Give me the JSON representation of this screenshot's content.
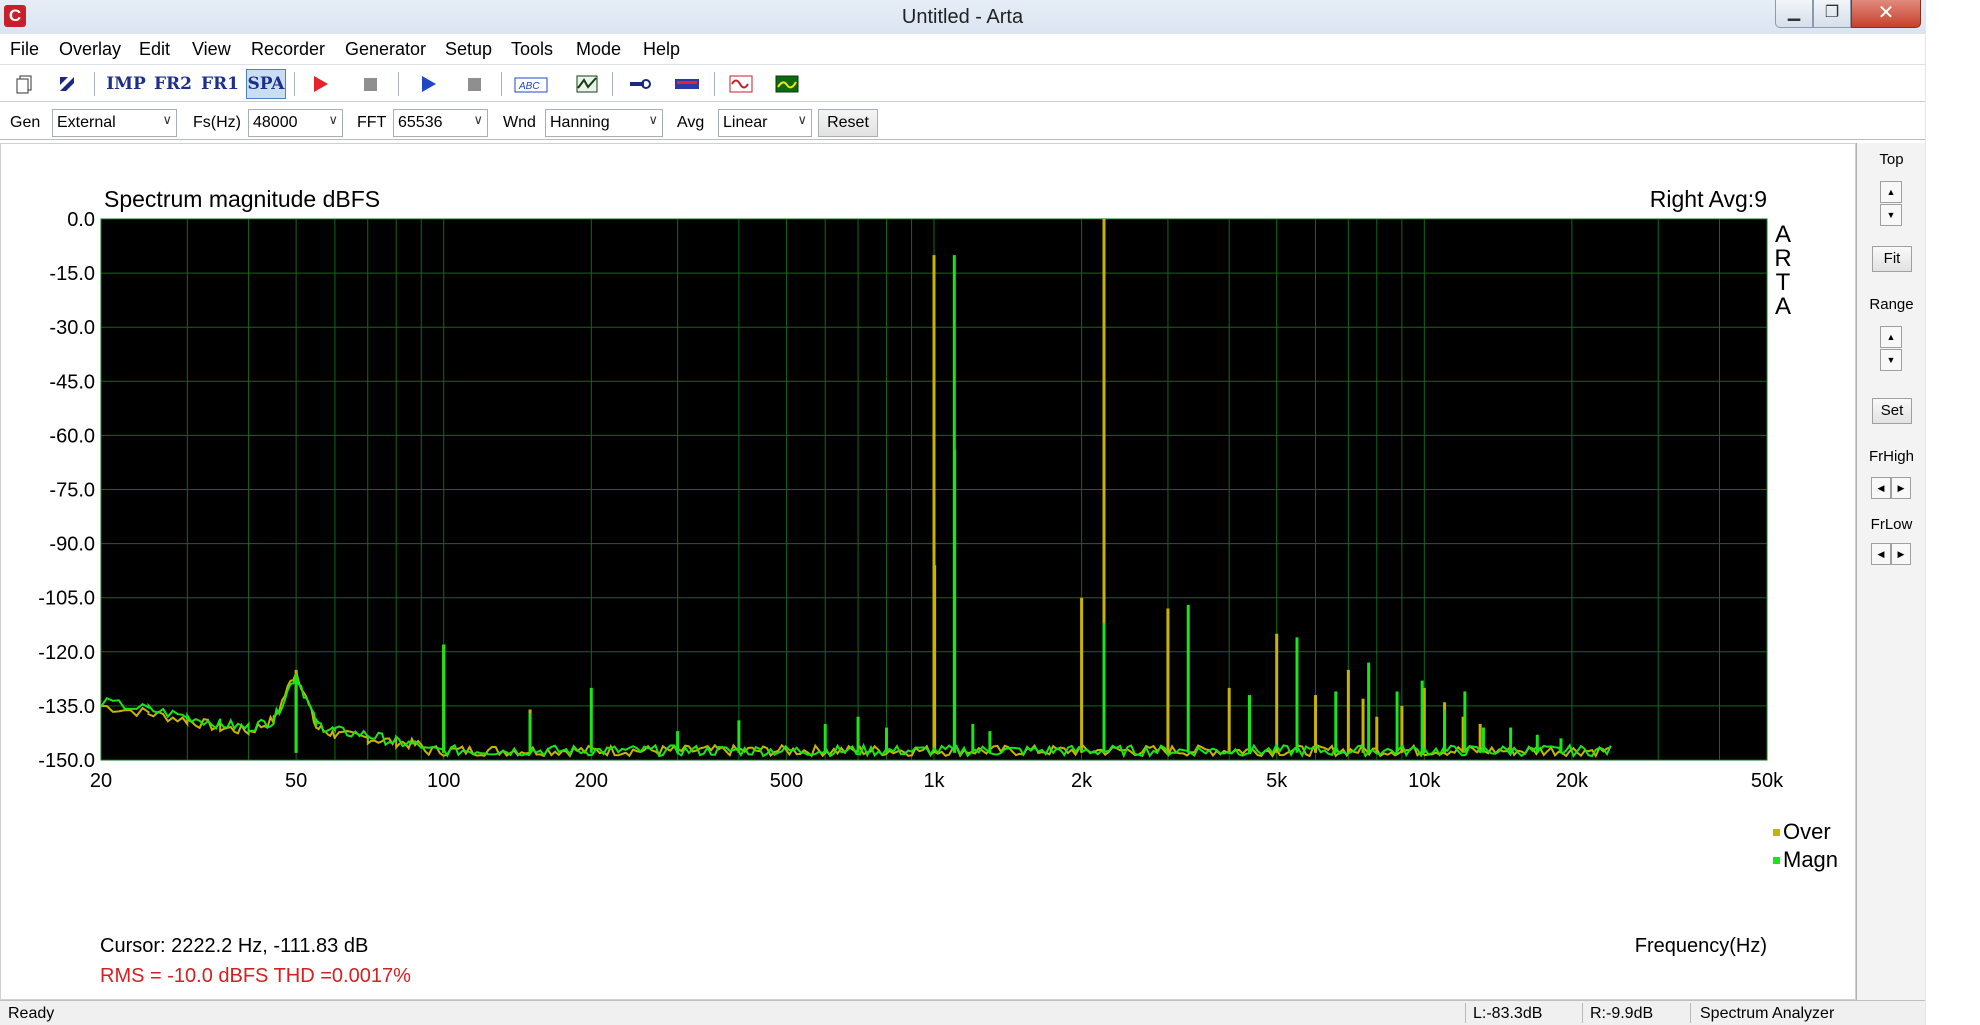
{
  "window": {
    "title": "Untitled - Arta",
    "logo_letter": "C",
    "minimize_glyph": "▁",
    "maximize_glyph": "❐",
    "close_glyph": "✕"
  },
  "menu": [
    "File",
    "Overlay",
    "Edit",
    "View",
    "Recorder",
    "Generator",
    "Setup",
    "Tools",
    "Mode",
    "Help"
  ],
  "toolbar": {
    "imp_label": "IMP",
    "fr2_label": "FR2",
    "fr1_label": "FR1",
    "spa_label": "SPA",
    "icons": [
      "new-document-icon",
      "open-icon",
      "imp-mode-icon",
      "fr2-mode-icon",
      "fr1-mode-icon",
      "spa-mode-icon",
      "record-icon",
      "stop-record-icon",
      "play-icon",
      "stop-play-icon",
      "abc-icon",
      "scope-icon",
      "probe-icon",
      "vu-meter-icon",
      "generator-icon",
      "analyzer-icon"
    ]
  },
  "settings": {
    "gen_label": "Gen",
    "gen_value": "External",
    "fs_label": "Fs(Hz)",
    "fs_value": "48000",
    "fft_label": "FFT",
    "fft_value": "65536",
    "wnd_label": "Wnd",
    "wnd_value": "Hanning",
    "avg_label": "Avg",
    "avg_value": "Linear",
    "reset_label": "Reset"
  },
  "plot": {
    "title": "Spectrum magnitude dBFS",
    "channel_info": "Right  Avg:9",
    "watermark": [
      "A",
      "R",
      "T",
      "A"
    ],
    "cursor_text": "Cursor:  2222.2 Hz, -111.83 dB",
    "rms_text": "RMS =  -10.0 dBFS    THD =0.0017%",
    "legend_over": "Over",
    "legend_magn": "Magn"
  },
  "chart_data": {
    "type": "line",
    "title": "Spectrum magnitude dBFS",
    "xlabel": "Frequency(Hz)",
    "ylabel": "",
    "x_scale": "log",
    "xlim": [
      20,
      50000
    ],
    "ylim": [
      -150,
      0
    ],
    "grid": true,
    "legend_position": "bottom-right",
    "background_color": "#000000",
    "grid_color": "#0e6b16",
    "y_ticks": [
      "0.0",
      "-15.0",
      "-30.0",
      "-45.0",
      "-60.0",
      "-75.0",
      "-90.0",
      "-105.0",
      "-120.0",
      "-135.0",
      "-150.0"
    ],
    "y_tick_values": [
      0,
      -15,
      -30,
      -45,
      -60,
      -75,
      -90,
      -105,
      -120,
      -135,
      -150
    ],
    "x_ticks": [
      "20",
      "50",
      "100",
      "200",
      "500",
      "1k",
      "2k",
      "5k",
      "10k",
      "20k",
      "50k"
    ],
    "x_tick_values": [
      20,
      50,
      100,
      200,
      500,
      1000,
      2000,
      5000,
      10000,
      20000,
      50000
    ],
    "noise_floor": -148,
    "series": [
      {
        "name": "Over",
        "color": "#c8b400",
        "peaks": [
          [
            50,
            -125
          ],
          [
            100,
            -118
          ],
          [
            150,
            -136
          ],
          [
            1000,
            -10
          ],
          [
            1003,
            -96
          ],
          [
            2000,
            -105
          ],
          [
            2222,
            0
          ],
          [
            3000,
            -108
          ],
          [
            4000,
            -130
          ],
          [
            5000,
            -115
          ],
          [
            6000,
            -132
          ],
          [
            7000,
            -125
          ],
          [
            7500,
            -133
          ],
          [
            8000,
            -138
          ],
          [
            9000,
            -135
          ],
          [
            10000,
            -130
          ],
          [
            11000,
            -134
          ],
          [
            12000,
            -138
          ],
          [
            13000,
            -140
          ]
        ],
        "low_band": [
          [
            20,
            -135
          ],
          [
            25,
            -137
          ],
          [
            30,
            -139
          ],
          [
            35,
            -141
          ],
          [
            40,
            -142
          ],
          [
            45,
            -139
          ],
          [
            50,
            -125
          ],
          [
            55,
            -141
          ],
          [
            60,
            -143
          ],
          [
            70,
            -144
          ],
          [
            80,
            -145
          ],
          [
            90,
            -146
          ]
        ]
      },
      {
        "name": "Magn",
        "color": "#19e619",
        "peaks": [
          [
            50,
            -126
          ],
          [
            100,
            -118
          ],
          [
            150,
            -137
          ],
          [
            200,
            -130
          ],
          [
            300,
            -142
          ],
          [
            400,
            -139
          ],
          [
            600,
            -140
          ],
          [
            700,
            -138
          ],
          [
            800,
            -141
          ],
          [
            1100,
            -10
          ],
          [
            1102,
            -64
          ],
          [
            1200,
            -140
          ],
          [
            1300,
            -142
          ],
          [
            2222,
            -112
          ],
          [
            3300,
            -107
          ],
          [
            4400,
            -132
          ],
          [
            5500,
            -116
          ],
          [
            6600,
            -131
          ],
          [
            7700,
            -123
          ],
          [
            8800,
            -131
          ],
          [
            9900,
            -128
          ],
          [
            11000,
            -136
          ],
          [
            12100,
            -131
          ],
          [
            13200,
            -141
          ],
          [
            15000,
            -141
          ],
          [
            17000,
            -143
          ],
          [
            19000,
            -144
          ]
        ],
        "low_band": [
          [
            20,
            -134
          ],
          [
            25,
            -136
          ],
          [
            30,
            -138
          ],
          [
            35,
            -140
          ],
          [
            40,
            -141
          ],
          [
            45,
            -139
          ],
          [
            50,
            -126
          ],
          [
            55,
            -140
          ],
          [
            60,
            -142
          ],
          [
            70,
            -143
          ],
          [
            80,
            -145
          ],
          [
            90,
            -146
          ]
        ]
      }
    ]
  },
  "right_panel": {
    "top_label": "Top",
    "fit_label": "Fit",
    "range_label": "Range",
    "set_label": "Set",
    "frhigh_label": "FrHigh",
    "frlow_label": "FrLow",
    "up_glyph": "▲",
    "down_glyph": "▼",
    "left_glyph": "◀",
    "right_glyph": "▶"
  },
  "status": {
    "ready": "Ready",
    "left_level": "L:-83.3dB",
    "right_level": "R:-9.9dB",
    "mode": "Spectrum Analyzer"
  }
}
